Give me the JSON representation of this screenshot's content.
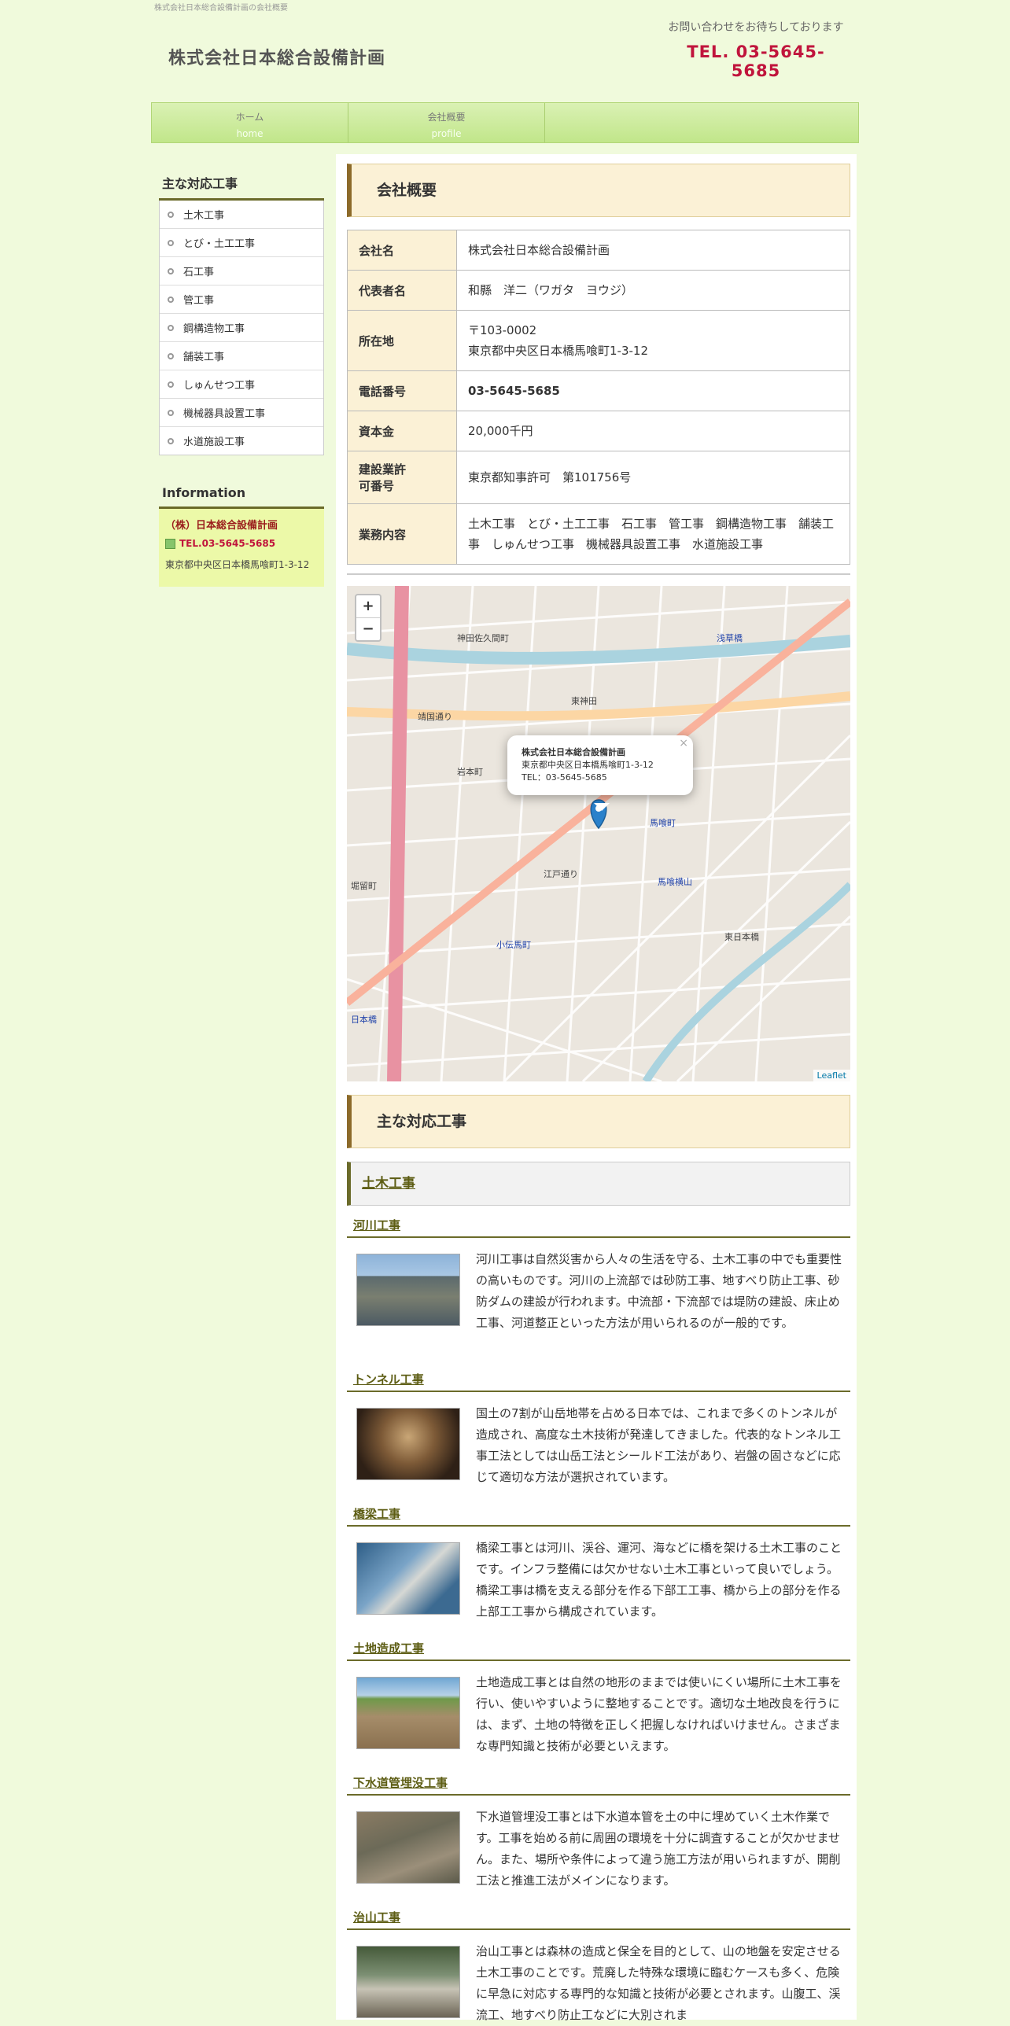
{
  "header": {
    "tagline": "株式会社日本総合設備計画の会社概要",
    "site_title": "株式会社日本総合設備計画",
    "contact_msg": "お問い合わせをお待ちしております",
    "contact_tel": "TEL. 03-5645-5685"
  },
  "nav": [
    {
      "ja": "ホーム",
      "en": "home"
    },
    {
      "ja": "会社概要",
      "en": "profile"
    }
  ],
  "sidebar": {
    "works_title": "主な対応工事",
    "works": [
      "土木工事",
      "とび・土工工事",
      "石工事",
      "管工事",
      "鋼構造物工事",
      "舗装工事",
      "しゅんせつ工事",
      "機械器具設置工事",
      "水道施設工事"
    ],
    "info_title": "Information",
    "info_name": "（株）日本総合設備計画",
    "info_tel": "TEL.03-5645-5685",
    "info_addr": "東京都中央区日本橋馬喰町1-3-12"
  },
  "profile": {
    "title": "会社概要",
    "rows": [
      {
        "th": "会社名",
        "td": "株式会社日本総合設備計画"
      },
      {
        "th": "代表者名",
        "td": "和縣　洋二（ワガタ　ヨウジ）"
      },
      {
        "th": "所在地",
        "td1": "〒103-0002",
        "td2": "東京都中央区日本橋馬喰町1-3-12"
      },
      {
        "th": "電話番号",
        "td": "03-5645-5685"
      },
      {
        "th": "資本金",
        "td": "20,000千円"
      },
      {
        "th1": "建設業許",
        "th2": "可番号",
        "td": "東京都知事許可　第101756号"
      },
      {
        "th": "業務内容",
        "td": "土木工事　とび・土工工事　石工事　管工事　鋼構造物工事　舗装工事　しゅんせつ工事　機械器具設置工事　水道施設工事"
      }
    ]
  },
  "map": {
    "zoom_in": "+",
    "zoom_out": "−",
    "popup_title": "株式会社日本総合設備計画",
    "popup_addr": "東京都中央区日本橋馬喰町1-3-12",
    "popup_tel": "TEL：03-5645-5685",
    "popup_close": "×",
    "attribution": "Leaflet",
    "labels": [
      "神田佐久間町",
      "東神田",
      "岩本町",
      "馬喰町",
      "馬喰横山",
      "小伝馬町",
      "浅草橋",
      "日本橋",
      "東日本橋",
      "堀留町",
      "靖国通り",
      "江戸通り"
    ]
  },
  "works": {
    "title": "主な対応工事",
    "category": "土木工事",
    "items": [
      {
        "title": "河川工事",
        "text": "河川工事は自然災害から人々の生活を守る、土木工事の中でも重要性の高いものです。河川の上流部では砂防工事、地すべり防止工事、砂防ダムの建設が行われます。中流部・下流部では堤防の建設、床止め工事、河道整正といった方法が用いられるのが一般的です。"
      },
      {
        "title": "トンネル工事",
        "text": "国土の7割が山岳地帯を占める日本では、これまで多くのトンネルが造成され、高度な土木技術が発達してきました。代表的なトンネル工事工法としては山岳工法とシールド工法があり、岩盤の固さなどに応じて適切な方法が選択されています。"
      },
      {
        "title": "橋梁工事",
        "text": "橋梁工事とは河川、渓谷、運河、海などに橋を架ける土木工事のことです。インフラ整備には欠かせない土木工事といって良いでしょう。橋梁工事は橋を支える部分を作る下部工工事、橋から上の部分を作る上部工工事から構成されています。"
      },
      {
        "title": "土地造成工事",
        "text": "土地造成工事とは自然の地形のままでは使いにくい場所に土木工事を行い、使いやすいように整地することです。適切な土地改良を行うには、まず、土地の特徴を正しく把握しなければいけません。さまざまな専門知識と技術が必要といえます。"
      },
      {
        "title": "下水道管埋没工事",
        "text": "下水道管埋没工事とは下水道本管を土の中に埋めていく土木作業です。工事を始める前に周囲の環境を十分に調査することが欠かせません。また、場所や条件によって違う施工方法が用いられますが、開削工法と推進工法がメインになります。"
      },
      {
        "title": "治山工事",
        "text": "治山工事とは森林の造成と保全を目的として、山の地盤を安定させる土木工事のことです。荒廃した特殊な環境に臨むケースも多く、危険に早急に対応する専門的な知識と技術が必要とされます。山腹工、渓流工、地すべり防止工などに大別されま"
      }
    ]
  }
}
